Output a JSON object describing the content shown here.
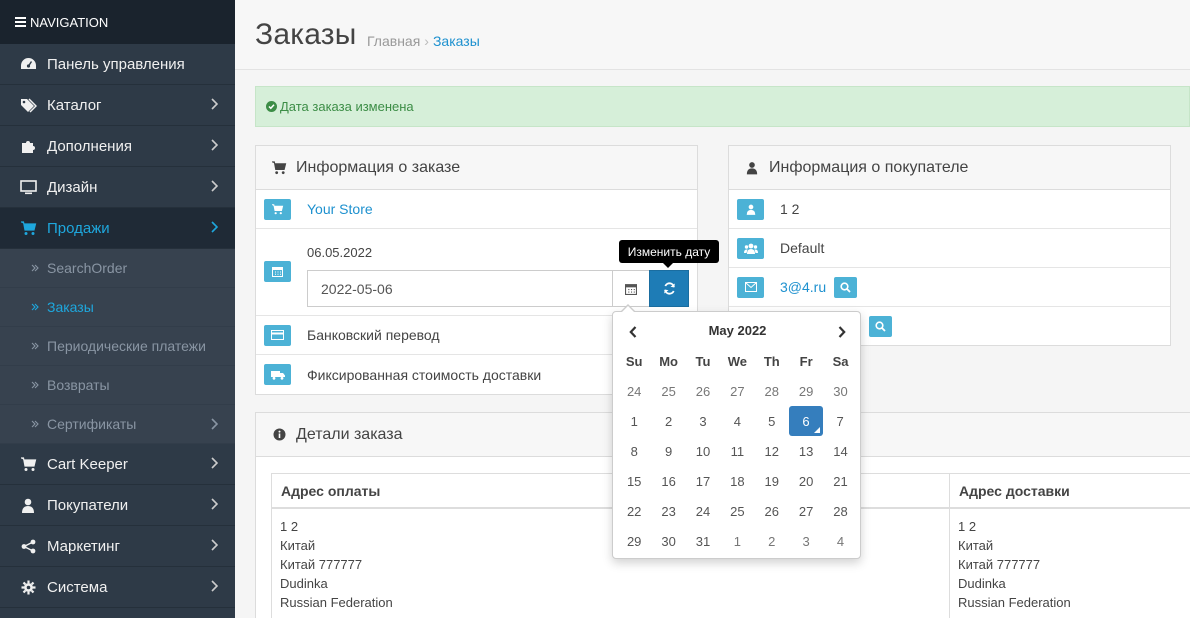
{
  "sidebar": {
    "header": "NAVIGATION",
    "items": [
      {
        "label": "Панель управления",
        "icon": "dashboard-icon"
      },
      {
        "label": "Каталог",
        "icon": "tags-icon"
      },
      {
        "label": "Дополнения",
        "icon": "puzzle-icon"
      },
      {
        "label": "Дизайн",
        "icon": "desktop-icon"
      },
      {
        "label": "Продажи",
        "icon": "cart-icon",
        "active": true
      }
    ],
    "sales_sub": [
      {
        "label": "SearchOrder"
      },
      {
        "label": "Заказы",
        "active": true
      },
      {
        "label": "Периодические платежи"
      },
      {
        "label": "Возвраты"
      },
      {
        "label": "Сертификаты"
      }
    ],
    "items_after": [
      {
        "label": "Cart Keeper",
        "icon": "cart-icon"
      },
      {
        "label": "Покупатели",
        "icon": "user-icon"
      },
      {
        "label": "Маркетинг",
        "icon": "share-icon"
      },
      {
        "label": "Система",
        "icon": "gear-icon"
      }
    ]
  },
  "header": {
    "title": "Заказы",
    "breadcrumb": [
      "Главная",
      "Заказы"
    ]
  },
  "alert": {
    "text": "Дата заказа изменена"
  },
  "order_info": {
    "title": "Информация о заказе",
    "store": "Your Store",
    "date_label": "06.05.2022",
    "date_value": "2022-05-06",
    "payment": "Банковский перевод",
    "shipping": "Фиксированная стоимость доставки"
  },
  "tooltip": "Изменить дату",
  "customer_info": {
    "title": "Информация о покупателе",
    "name": "1 2",
    "group": "Default",
    "email": "3@4.ru"
  },
  "details": {
    "title": "Детали заказа",
    "billing_header": "Адрес оплаты",
    "shipping_header": "Адрес доставки",
    "billing_lines": [
      "1 2",
      "Китай",
      "Китай 777777",
      "Dudinka",
      "Russian Federation"
    ],
    "shipping_lines": [
      "1 2",
      "Китай",
      "Китай 777777",
      "Dudinka",
      "Russian Federation"
    ]
  },
  "datepicker": {
    "month": "May 2022",
    "weekdays": [
      "Su",
      "Mo",
      "Tu",
      "We",
      "Th",
      "Fr",
      "Sa"
    ],
    "weeks": [
      [
        "24",
        "25",
        "26",
        "27",
        "28",
        "29",
        "30"
      ],
      [
        "1",
        "2",
        "3",
        "4",
        "5",
        "6",
        "7"
      ],
      [
        "8",
        "9",
        "10",
        "11",
        "12",
        "13",
        "14"
      ],
      [
        "15",
        "16",
        "17",
        "18",
        "19",
        "20",
        "21"
      ],
      [
        "22",
        "23",
        "24",
        "25",
        "26",
        "27",
        "28"
      ],
      [
        "29",
        "30",
        "31",
        "1",
        "2",
        "3",
        "4"
      ]
    ],
    "selected": "6"
  },
  "colors": {
    "accent": "#1e91cf",
    "sidebar": "#2e3a47",
    "badge": "#4cb2d6",
    "success_bg": "#d6efd9"
  }
}
